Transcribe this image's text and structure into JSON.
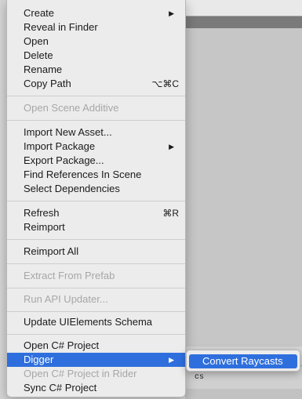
{
  "menu": {
    "create": "Create",
    "reveal_in_finder": "Reveal in Finder",
    "open": "Open",
    "delete": "Delete",
    "rename": "Rename",
    "copy_path": "Copy Path",
    "copy_path_shortcut": "⌥⌘C",
    "open_scene_additive": "Open Scene Additive",
    "import_new_asset": "Import New Asset...",
    "import_package": "Import Package",
    "export_package": "Export Package...",
    "find_references_in_scene": "Find References In Scene",
    "select_dependencies": "Select Dependencies",
    "refresh": "Refresh",
    "refresh_shortcut": "⌘R",
    "reimport": "Reimport",
    "reimport_all": "Reimport All",
    "extract_from_prefab": "Extract From Prefab",
    "run_api_updater": "Run API Updater...",
    "update_uielements_schema": "Update UIElements Schema",
    "open_csharp_project": "Open C# Project",
    "digger": "Digger",
    "open_csharp_project_in_rider": "Open C# Project in Rider",
    "sync_csharp_project": "Sync C# Project",
    "submenu_arrow": "▶"
  },
  "submenu": {
    "convert_raycasts": "Convert Raycasts"
  },
  "background": {
    "status_text": "cs"
  },
  "colors": {
    "highlight": "#2e6fdd",
    "disabled_text": "#a7a7a7",
    "menu_bg": "#ececec"
  }
}
